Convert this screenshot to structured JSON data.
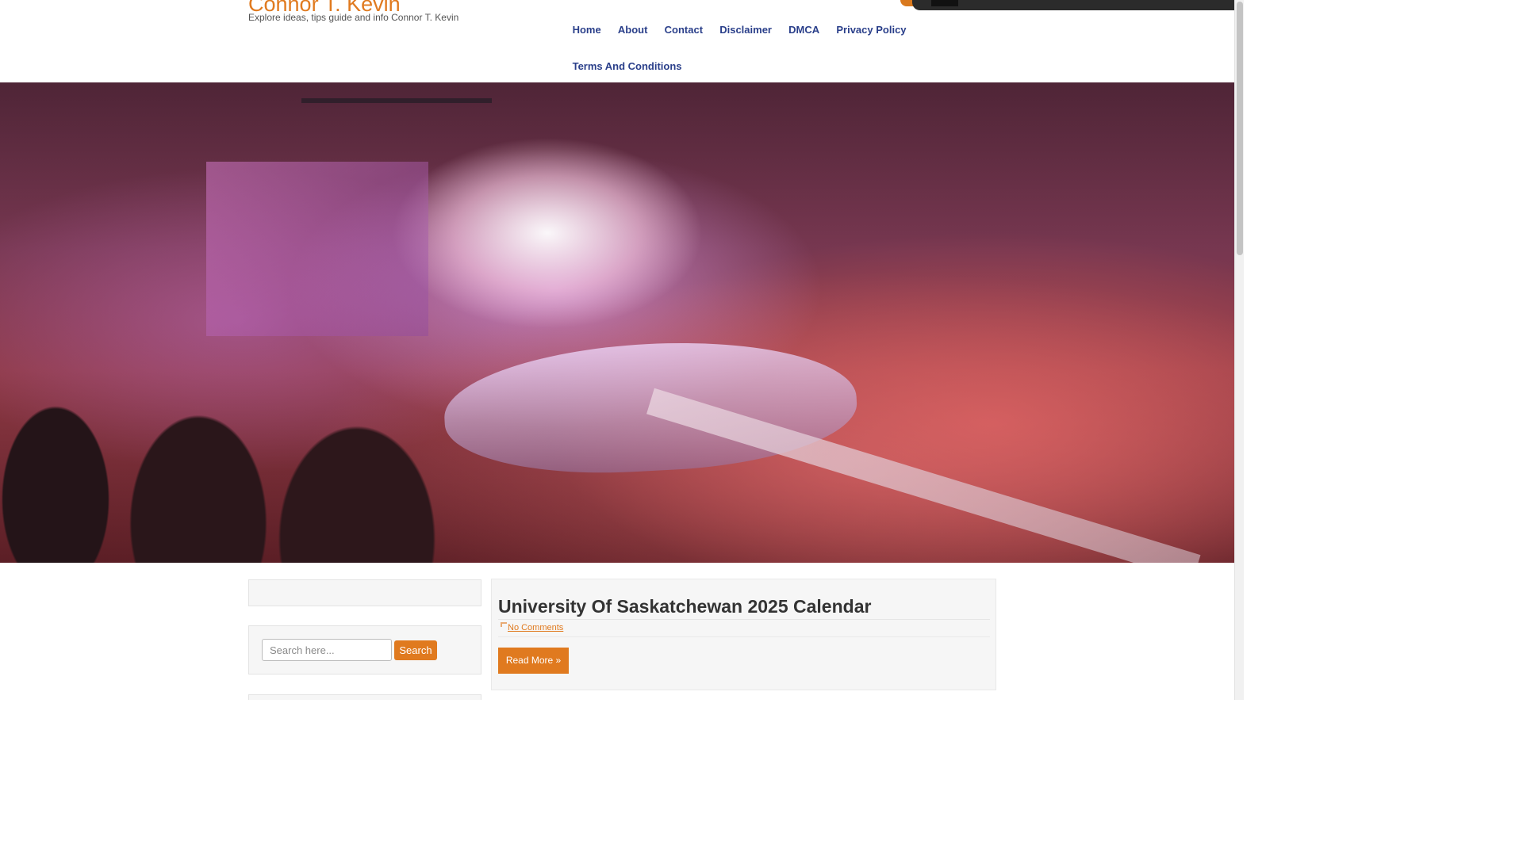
{
  "site": {
    "title": "Connor T. Kevin",
    "tagline": "Explore ideas, tips guide and info Connor T. Kevin"
  },
  "nav": {
    "items": [
      "Home",
      "About",
      "Contact",
      "Disclaimer",
      "DMCA",
      "Privacy Policy",
      "Terms And Conditions"
    ]
  },
  "search": {
    "placeholder": "Search here...",
    "value": "",
    "button_label": "Search"
  },
  "post": {
    "title": "University Of Saskatchewan 2025 Calendar",
    "comments": "No Comments",
    "read_more": "Read More »"
  },
  "colors": {
    "accent": "#e07a1f",
    "nav_link": "#2a3f8a",
    "topbar": "#2b2b2b"
  }
}
